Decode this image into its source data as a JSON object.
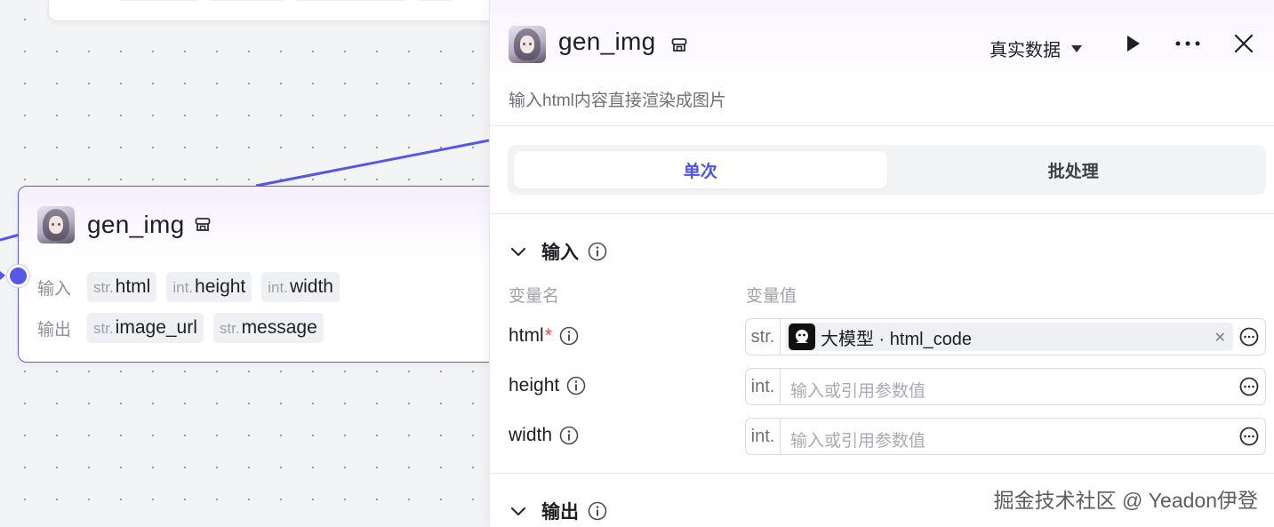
{
  "node": {
    "title": "gen_img",
    "input_label": "输入",
    "output_label": "输出",
    "inputs": [
      {
        "type": "str.",
        "name": "html"
      },
      {
        "type": "int.",
        "name": "height"
      },
      {
        "type": "int.",
        "name": "width"
      }
    ],
    "outputs": [
      {
        "type": "str.",
        "name": "image_url"
      },
      {
        "type": "str.",
        "name": "message"
      }
    ]
  },
  "panel": {
    "title": "gen_img",
    "description": "输入html内容直接渲染成图片",
    "data_mode": "真实数据",
    "tabs": {
      "single": "单次",
      "batch": "批处理"
    },
    "input_section": {
      "title": "输入",
      "col_name": "变量名",
      "col_value": "变量值",
      "params": [
        {
          "name": "html",
          "required": "*",
          "type": "str.",
          "ref_source": "大模型",
          "ref_sep": " · ",
          "ref_var": "html_code"
        },
        {
          "name": "height",
          "type": "int.",
          "placeholder": "输入或引用参数值"
        },
        {
          "name": "width",
          "type": "int.",
          "placeholder": "输入或引用参数值"
        }
      ]
    },
    "output_section": {
      "title": "输出"
    }
  },
  "watermark": "掘金技术社区 @ Yeadon伊登",
  "colors": {
    "accent": "#4d53e8",
    "edge": "#5558e6",
    "required": "#e5484d"
  }
}
